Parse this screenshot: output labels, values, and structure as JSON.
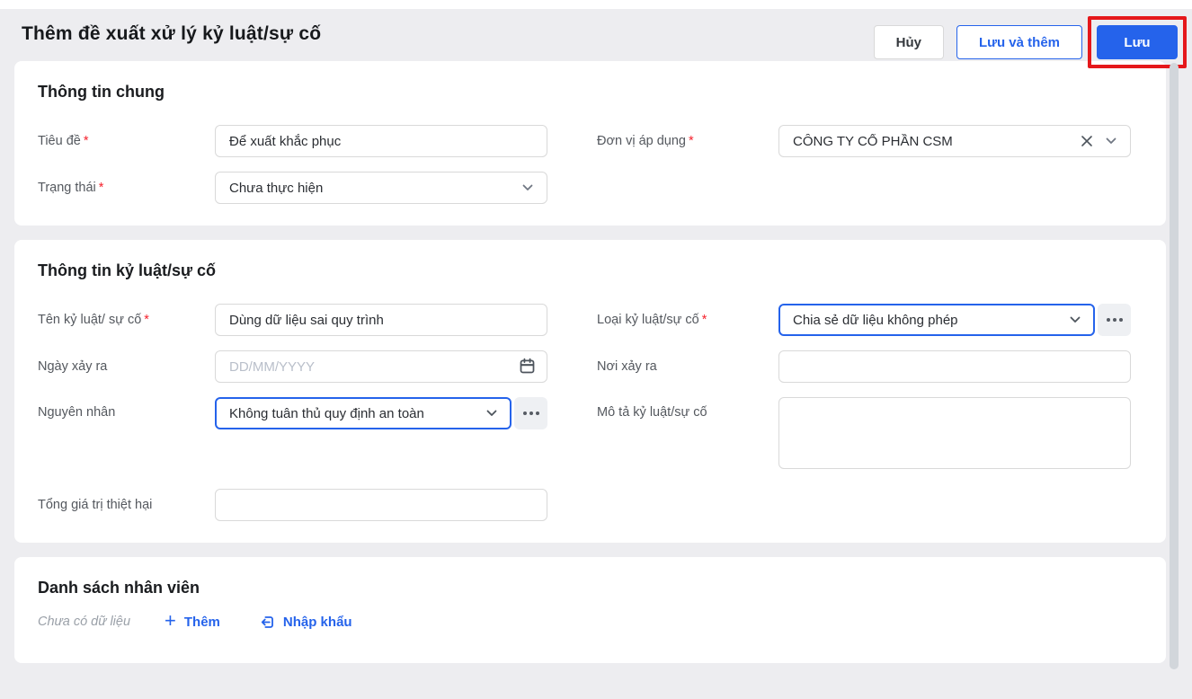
{
  "colors": {
    "accent_blue": "#2563eb",
    "annotation_red": "#e5181b",
    "page_bg": "#ededf0"
  },
  "required_marker": "*",
  "header": {
    "title": "Thêm đề xuất xử lý kỷ luật/sự cố",
    "buttons": {
      "cancel": "Hủy",
      "save_and_add": "Lưu và thêm",
      "save": "Lưu"
    }
  },
  "general_info": {
    "heading": "Thông tin chung",
    "fields": {
      "title": {
        "label": "Tiêu đề",
        "value": "Để xuất khắc phục"
      },
      "applied_unit": {
        "label": "Đơn vị áp dụng",
        "value": "CÔNG TY CỔ PHẦN CSM"
      },
      "status": {
        "label": "Trạng thái",
        "value": "Chưa thực hiện"
      }
    }
  },
  "incident_info": {
    "heading": "Thông tin kỷ luật/sự cố",
    "fields": {
      "name": {
        "label": "Tên kỷ luật/ sự cố",
        "value": "Dùng dữ liệu sai quy trình"
      },
      "type": {
        "label": "Loại kỷ luật/sự cố",
        "value": "Chia sẻ dữ liệu không phép"
      },
      "date": {
        "label": "Ngày xảy ra",
        "placeholder": "DD/MM/YYYY",
        "value": ""
      },
      "location": {
        "label": "Nơi xảy ra",
        "value": ""
      },
      "cause": {
        "label": "Nguyên nhân",
        "value": "Không tuân thủ quy định an toàn"
      },
      "description": {
        "label": "Mô tả kỷ luật/sự cố",
        "value": ""
      },
      "total_damage": {
        "label": "Tổng giá trị thiệt hại",
        "value": ""
      }
    }
  },
  "employee_list": {
    "heading": "Danh sách nhân viên",
    "empty_text": "Chưa có dữ liệu",
    "add_label": "Thêm",
    "import_label": "Nhập khẩu"
  }
}
